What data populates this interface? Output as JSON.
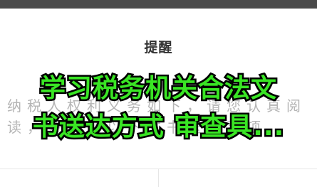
{
  "dialog": {
    "title": "提醒",
    "body": "纳税人权利义务如下，请您认真阅读，并确认以下文书送达事项。",
    "cancel_label": "",
    "confirm_label": ""
  },
  "overlay": {
    "line1": "学习税务机关合法文",
    "line2": "书送达方式 审查具...",
    "color": "#39e524",
    "stroke": "#000000"
  }
}
